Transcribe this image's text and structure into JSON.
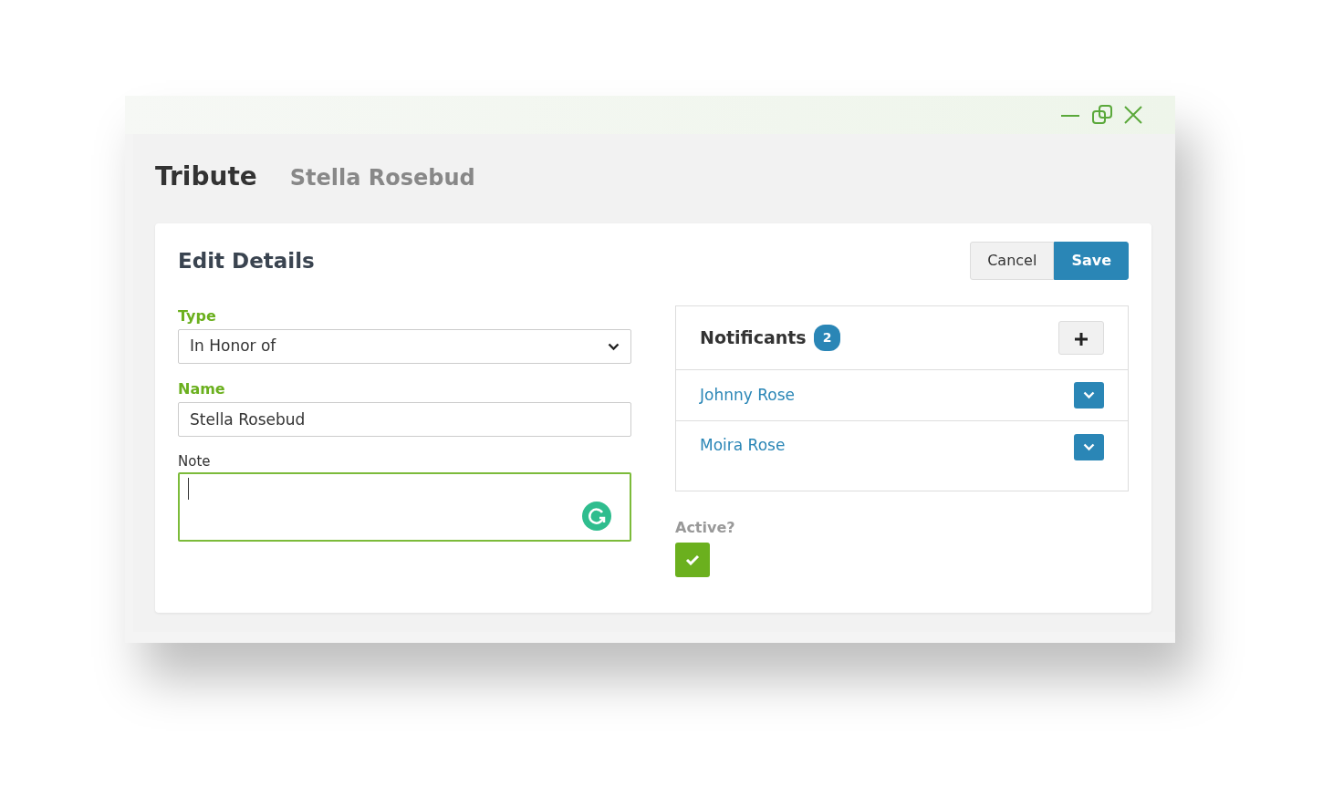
{
  "header": {
    "title": "Tribute",
    "subtitle": "Stella Rosebud"
  },
  "card": {
    "title": "Edit Details",
    "buttons": [
      {
        "label": "Cancel",
        "kind": "secondary"
      },
      {
        "label": "Save",
        "kind": "primary"
      }
    ]
  },
  "form": {
    "type": {
      "label": "Type",
      "value": "In Honor of"
    },
    "name": {
      "label": "Name",
      "value": "Stella Rosebud"
    },
    "note": {
      "label": "Note",
      "focused": true
    }
  },
  "notificants": {
    "title": "Notificants",
    "count": "2",
    "items": [
      {
        "name": "Johnny Rose"
      },
      {
        "name": "Moira Rose"
      }
    ]
  },
  "active": {
    "label": "Active?",
    "checked": true
  }
}
